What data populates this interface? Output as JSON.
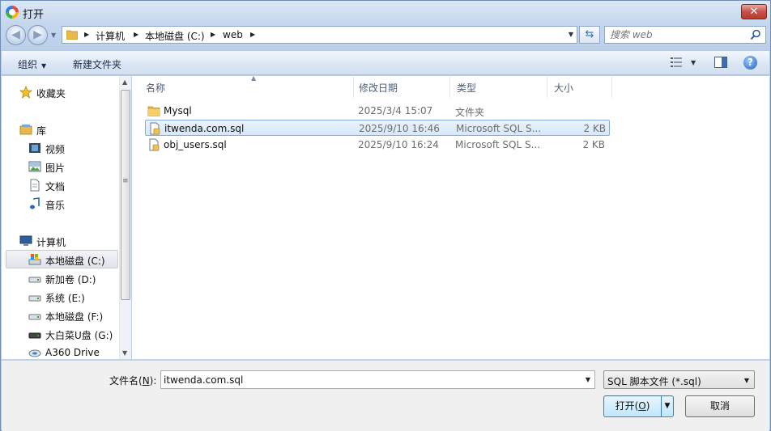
{
  "window": {
    "title": "打开",
    "close_label": "✕"
  },
  "address": {
    "crumbs": [
      "计算机",
      "本地磁盘 (C:)",
      "web"
    ],
    "search_placeholder": "搜索 web"
  },
  "toolbar": {
    "organize": "组织",
    "new_folder": "新建文件夹"
  },
  "nav": {
    "favorites": "收藏夹",
    "library": "库",
    "videos": "视频",
    "pictures": "图片",
    "documents": "文档",
    "music": "音乐",
    "computer": "计算机",
    "drive_c": "本地磁盘 (C:)",
    "drive_d": "新加卷 (D:)",
    "drive_e": "系统 (E:)",
    "drive_f": "本地磁盘 (F:)",
    "drive_g": "大白菜U盘 (G:)",
    "a360": "A360 Drive"
  },
  "columns": {
    "name": "名称",
    "date": "修改日期",
    "type": "类型",
    "size": "大小"
  },
  "files": [
    {
      "name": "Mysql",
      "date": "2025/3/4 15:07",
      "type": "文件夹",
      "size": "",
      "icon": "folder-icon"
    },
    {
      "name": "itwenda.com.sql",
      "date": "2025/9/10 16:46",
      "type": "Microsoft SQL S...",
      "size": "2 KB",
      "icon": "sql-file-icon"
    },
    {
      "name": "obj_users.sql",
      "date": "2025/9/10 16:24",
      "type": "Microsoft SQL S...",
      "size": "2 KB",
      "icon": "sql-file-icon"
    }
  ],
  "bottom": {
    "filename_label": "文件名(",
    "filename_key": "N",
    "filename_label_end": "):",
    "filename_value": "itwenda.com.sql",
    "filter": "SQL 脚本文件 (*.sql)",
    "open_label": "打开(",
    "open_key": "O",
    "open_label_end": ")",
    "cancel_label": "取消"
  },
  "colors": {
    "accent": "#3c7fb1",
    "selection": "#d6e8fc",
    "folder": "#e8b84a"
  }
}
